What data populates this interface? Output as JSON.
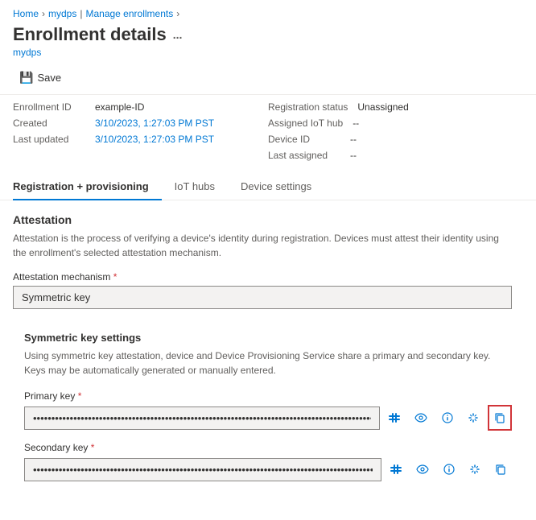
{
  "breadcrumb": {
    "items": [
      {
        "label": "Home",
        "link": true
      },
      {
        "label": "mydps",
        "link": true
      },
      {
        "label": "Manage enrollments",
        "link": true
      }
    ]
  },
  "header": {
    "title": "Enrollment details",
    "subtitle": "mydps",
    "ellipsis": "..."
  },
  "toolbar": {
    "save_label": "Save"
  },
  "details": {
    "left": [
      {
        "label": "Enrollment ID",
        "value": "example-ID",
        "blue": false
      },
      {
        "label": "Created",
        "value": "3/10/2023, 1:27:03 PM PST",
        "blue": true
      },
      {
        "label": "Last updated",
        "value": "3/10/2023, 1:27:03 PM PST",
        "blue": true
      }
    ],
    "right": [
      {
        "label": "Registration status",
        "value": "Unassigned"
      },
      {
        "label": "Assigned IoT hub",
        "value": "--"
      },
      {
        "label": "Device ID",
        "value": "--"
      },
      {
        "label": "Last assigned",
        "value": "--"
      }
    ]
  },
  "tabs": [
    {
      "label": "Registration + provisioning",
      "active": true
    },
    {
      "label": "IoT hubs",
      "active": false
    },
    {
      "label": "Device settings",
      "active": false
    }
  ],
  "attestation": {
    "section_title": "Attestation",
    "section_desc": "Attestation is the process of verifying a device's identity during registration. Devices must attest their identity using the enrollment's selected attestation mechanism.",
    "mechanism_label": "Attestation mechanism",
    "mechanism_value": "Symmetric key",
    "subsection_title": "Symmetric key settings",
    "subsection_desc": "Using symmetric key attestation, device and Device Provisioning Service share a primary and secondary key. Keys may be automatically generated or manually entered.",
    "primary_key_label": "Primary key",
    "primary_key_placeholder": "••••••••••••••••••••••••••••••••••••••••••••••••••••••••••••••••••••••••••••",
    "secondary_key_label": "Secondary key",
    "secondary_key_placeholder": "••••••••••••••••••••••••••••••••••••••••••••••••••••••••••••••••••••••••••••",
    "required_star": "*"
  },
  "icons": {
    "save": "💾",
    "chevron": "›",
    "eye": "👁",
    "regenerate": "⇅",
    "copy": "⧉",
    "info": "ℹ"
  }
}
